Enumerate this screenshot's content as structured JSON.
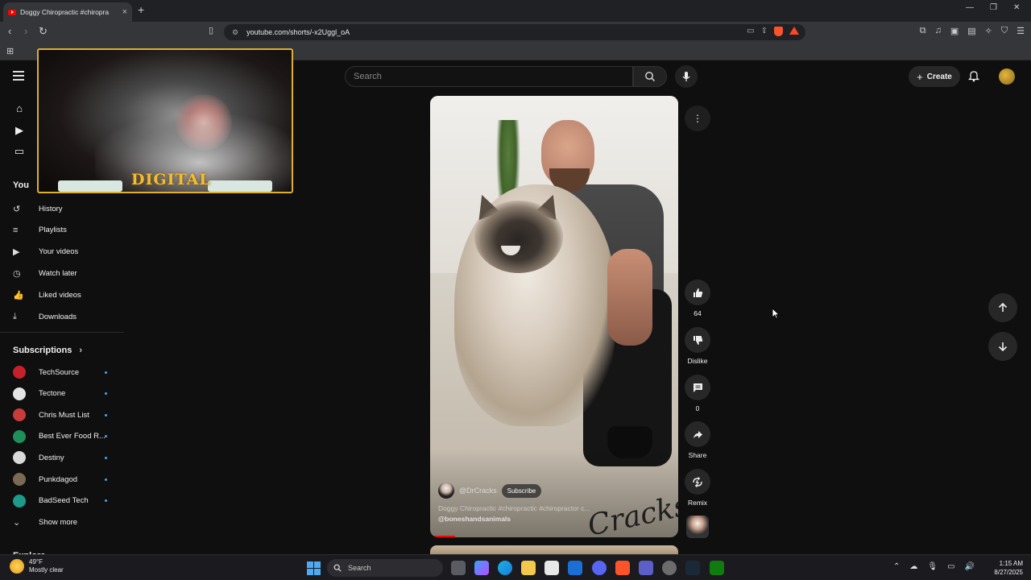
{
  "browser": {
    "tab_title": "Doggy Chiropractic #chiropra",
    "tab_close": "×",
    "new_tab": "+",
    "url": "youtube.com/shorts/-x2Uggl_oA",
    "window_min": "—",
    "window_max": "❐",
    "window_close": "✕"
  },
  "youtube": {
    "search_placeholder": "Search",
    "create_label": "Create",
    "you_section": "You",
    "you_items": [
      {
        "label": "History",
        "icon": "history-icon"
      },
      {
        "label": "Playlists",
        "icon": "playlists-icon"
      },
      {
        "label": "Your videos",
        "icon": "your-videos-icon"
      },
      {
        "label": "Watch later",
        "icon": "watch-later-icon"
      },
      {
        "label": "Liked videos",
        "icon": "liked-videos-icon"
      },
      {
        "label": "Downloads",
        "icon": "downloads-icon"
      }
    ],
    "subscriptions_title": "Subscriptions",
    "subscriptions": [
      {
        "name": "TechSource",
        "color": "#c8202a"
      },
      {
        "name": "Tectone",
        "color": "#e4e4e4"
      },
      {
        "name": "Chris Must List",
        "color": "#c73b3b"
      },
      {
        "name": "Best Ever Food R...",
        "color": "#1e8f5a"
      },
      {
        "name": "Destiny",
        "color": "#d9d9d9"
      },
      {
        "name": "Punkdagod",
        "color": "#7a6a55"
      },
      {
        "name": "BadSeed Tech",
        "color": "#1d9a8a"
      }
    ],
    "show_more": "Show more",
    "explore_title": "Explore"
  },
  "overlay": {
    "logo_text": "DIGITAL"
  },
  "short": {
    "channel_handle": "@DrCracks",
    "subscribe_label": "Subscribe",
    "caption": "Doggy Chiropractic #chiropractic #chiropractor c...",
    "mention": "@boneshandsanimals",
    "watermark": "Cracks",
    "progress": 0.1,
    "actions": {
      "like_count": "64",
      "dislike_label": "Dislike",
      "comment_count": "0",
      "share_label": "Share",
      "remix_label": "Remix"
    }
  },
  "taskbar": {
    "temperature": "49°F",
    "weather": "Mostly clear",
    "search_label": "Search",
    "time": "1:15 AM",
    "date": "8/27/2025"
  },
  "colors": {
    "accent_red": "#ff0000",
    "link_blue": "#3ea6ff",
    "overlay_gold": "#e0b02a"
  }
}
